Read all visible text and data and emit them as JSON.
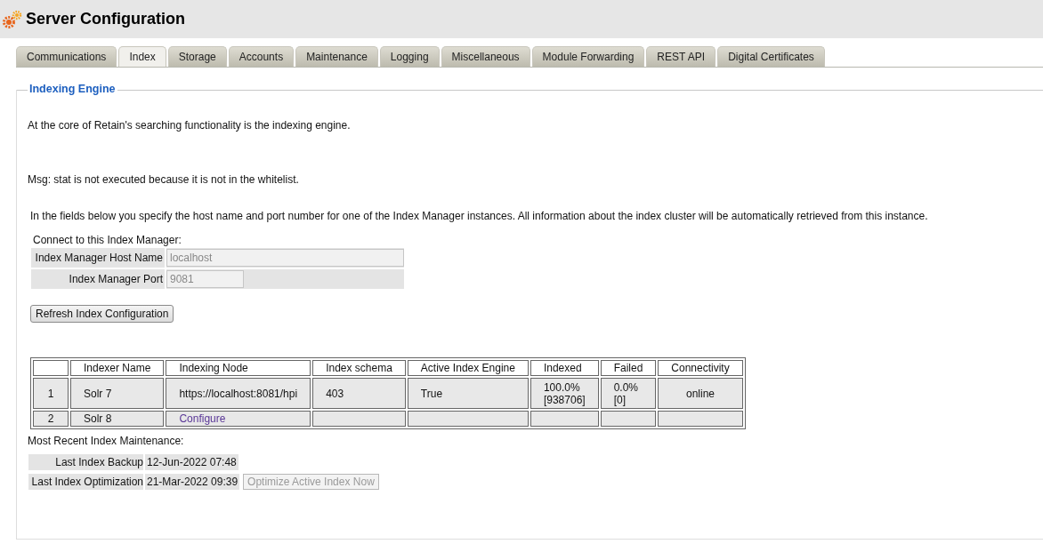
{
  "header": {
    "title": "Server Configuration"
  },
  "tabs": [
    {
      "label": "Communications",
      "selected": false
    },
    {
      "label": "Index",
      "selected": true
    },
    {
      "label": "Storage",
      "selected": false
    },
    {
      "label": "Accounts",
      "selected": false
    },
    {
      "label": "Maintenance",
      "selected": false
    },
    {
      "label": "Logging",
      "selected": false
    },
    {
      "label": "Miscellaneous",
      "selected": false
    },
    {
      "label": "Module Forwarding",
      "selected": false
    },
    {
      "label": "REST API",
      "selected": false
    },
    {
      "label": "Digital Certificates",
      "selected": false
    }
  ],
  "section": {
    "legend": "Indexing Engine",
    "intro": "At the core of Retain's searching functionality is the indexing engine.",
    "message": "Msg: stat is not executed because it is not in the whitelist.",
    "description": "In the fields below you specify the host name and port number for one of the Index Manager instances. All information about the index cluster will be automatically retrieved from this instance.",
    "connect_label": "Connect to this Index Manager:",
    "fields": [
      {
        "label": "Index Manager Host Name",
        "value": "localhost",
        "disabled": true,
        "kind": "wide"
      },
      {
        "label": "Index Manager Port",
        "value": "9081",
        "disabled": true,
        "kind": "narrow"
      }
    ],
    "refresh_button": "Refresh Index Configuration",
    "table": {
      "columns": [
        "Indexer Name",
        "Indexing Node",
        "Index schema",
        "Active Index Engine",
        "Indexed",
        "Failed",
        "Connectivity"
      ],
      "rows": [
        {
          "number": "1",
          "name": "Solr 7",
          "node": {
            "text": "https://localhost:8081/hpi",
            "kind": "text"
          },
          "schema": "403",
          "active": "True",
          "indexed": [
            "100.0%",
            "[938706]"
          ],
          "failed": [
            "0.0%",
            "[0]"
          ],
          "connectivity": "online"
        },
        {
          "number": "2",
          "name": "Solr 8",
          "node": {
            "text": "Configure",
            "kind": "link"
          }
        }
      ]
    },
    "maintenance_label": "Most Recent Index Maintenance:",
    "maintenance": [
      {
        "label": "Last Index Backup",
        "value": "12-Jun-2022 07:48"
      },
      {
        "label": "Last Index Optimization",
        "value": "21-Mar-2022 09:39",
        "button": {
          "label": "Optimize Active Index Now",
          "disabled": true
        }
      }
    ]
  }
}
